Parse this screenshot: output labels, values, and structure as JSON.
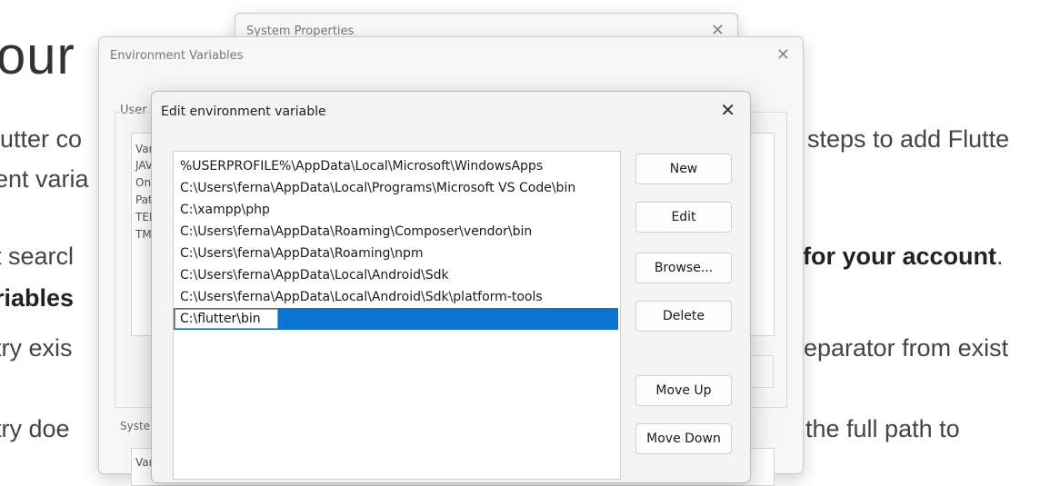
{
  "article": {
    "heading": "our",
    "line1_left": "lutter co",
    "line1_right": "steps to add Flutte",
    "line2_left": "ent varia",
    "line3_left": "t searcl",
    "line3_right_bold": "for your account",
    "line3_right_end": ".",
    "line4_left_bold": "riables",
    "line5_left": "try exis",
    "line5_right": "eparator from exist",
    "line6_left": "try doe",
    "line6_right": "the full path to"
  },
  "system_properties": {
    "title": "System Properties",
    "close": "✕"
  },
  "environment_variables": {
    "title": "Environment Variables",
    "close": "✕",
    "user_label": "User",
    "user_list": [
      "Var",
      "JAV",
      "On",
      "Pat",
      "TEI",
      "TM"
    ],
    "system_label": "Syste",
    "system_list": [
      "Var"
    ]
  },
  "edit_dialog": {
    "title": "Edit environment variable",
    "close": "✕",
    "paths": [
      "%USERPROFILE%\\AppData\\Local\\Microsoft\\WindowsApps",
      "C:\\Users\\ferna\\AppData\\Local\\Programs\\Microsoft VS Code\\bin",
      "C:\\xampp\\php",
      "C:\\Users\\ferna\\AppData\\Roaming\\Composer\\vendor\\bin",
      "C:\\Users\\ferna\\AppData\\Roaming\\npm",
      "C:\\Users\\ferna\\AppData\\Local\\Android\\Sdk",
      "C:\\Users\\ferna\\AppData\\Local\\Android\\Sdk\\platform-tools"
    ],
    "editing_value": "C:\\flutter\\bin",
    "buttons": {
      "new": "New",
      "edit": "Edit",
      "browse": "Browse...",
      "delete": "Delete",
      "move_up": "Move Up",
      "move_down": "Move Down"
    }
  },
  "colors": {
    "selection": "#0a74d4"
  }
}
